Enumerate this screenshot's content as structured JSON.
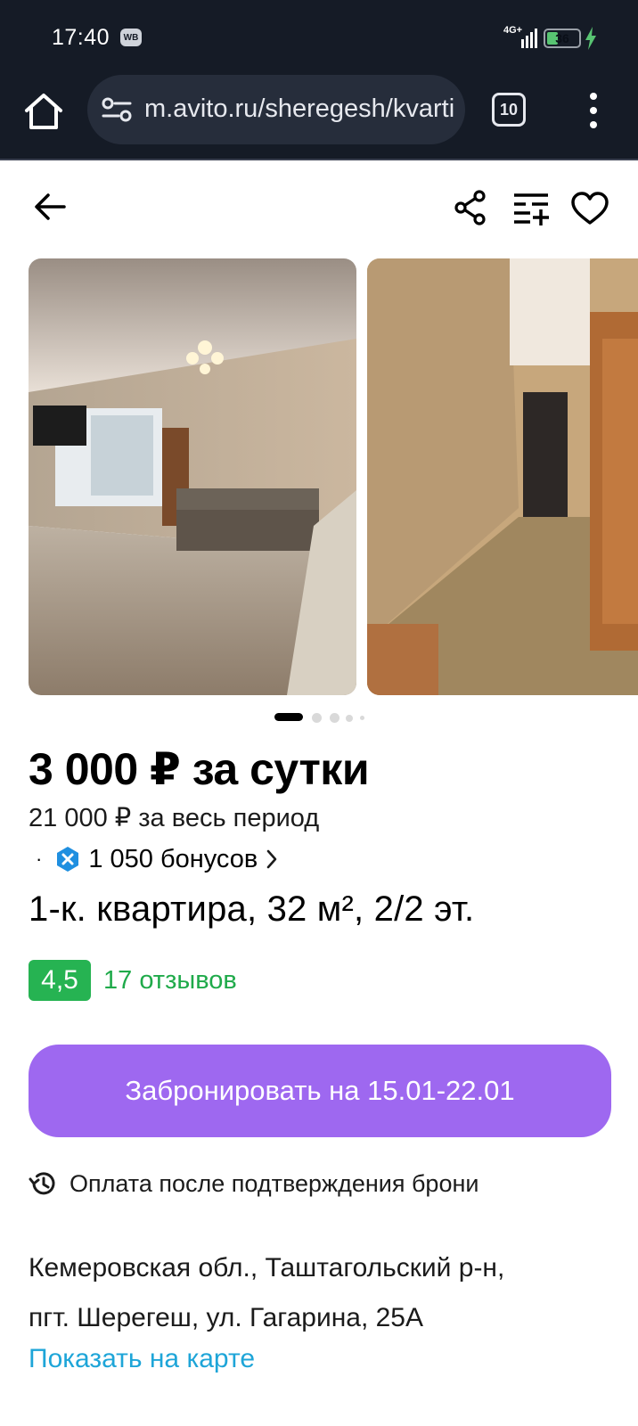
{
  "status_bar": {
    "time": "17:40",
    "app_badge": "WB",
    "network": "4G+",
    "battery_level": "36",
    "battery_fraction": 0.36
  },
  "browser": {
    "url": "m.avito.ru/sheregesh/kvartiry",
    "tab_count": "10"
  },
  "listing": {
    "price_per_day": "3 000 ₽ за сутки",
    "price_total": "21 000 ₽ за весь период",
    "bonus_separator": "·",
    "bonus_text": "1 050 бонусов",
    "title": "1-к. квартира, 32 м², 2/2 эт.",
    "rating": "4,5",
    "reviews": "17 отзывов",
    "book_button": "Забронировать на 15.01-22.01",
    "payment_note": "Оплата после подтверждения брони",
    "address_line1": "Кемеровская обл., Таштагольский р-н,",
    "address_line2": "пгт. Шерегеш, ул. Гагарина, 25А",
    "map_link": "Показать на карте"
  },
  "gallery": {
    "photo_count": 5,
    "active_index": 0
  },
  "colors": {
    "status_bg": "#151b26",
    "book_button": "#9e68f0",
    "rating_green": "#26b352",
    "link_blue": "#1ea5d8",
    "bonus_blue": "#1f8fe0"
  }
}
